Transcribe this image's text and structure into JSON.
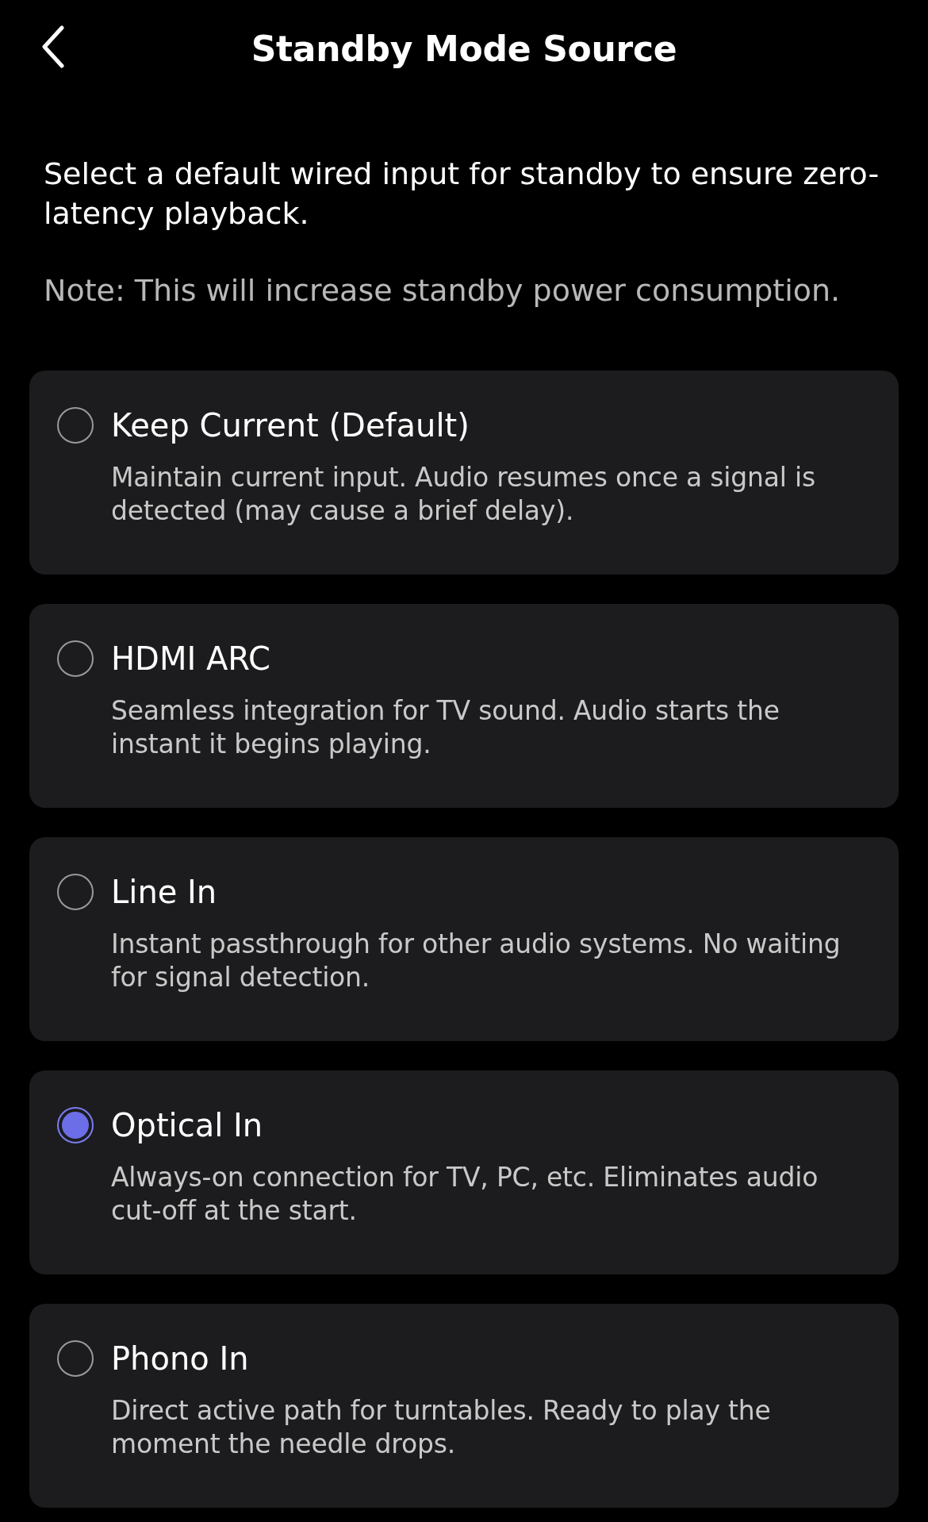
{
  "header": {
    "title": "Standby Mode Source"
  },
  "intro": "Select a default wired input for standby to ensure zero-latency playback.",
  "note": "Note: This will increase standby power consumption.",
  "options": [
    {
      "title": "Keep Current (Default)",
      "description": "Maintain current input. Audio resumes once a signal is detected (may cause a brief delay).",
      "selected": false
    },
    {
      "title": "HDMI ARC",
      "description": "Seamless integration for TV sound. Audio starts the instant it begins playing.",
      "selected": false
    },
    {
      "title": "Line In",
      "description": "Instant passthrough for other audio systems. No waiting for signal detection.",
      "selected": false
    },
    {
      "title": "Optical In",
      "description": "Always-on connection for TV, PC, etc. Eliminates audio cut-off at the start.",
      "selected": true
    },
    {
      "title": "Phono In",
      "description": "Direct active path for turntables. Ready to play the moment the needle drops.",
      "selected": false
    }
  ]
}
